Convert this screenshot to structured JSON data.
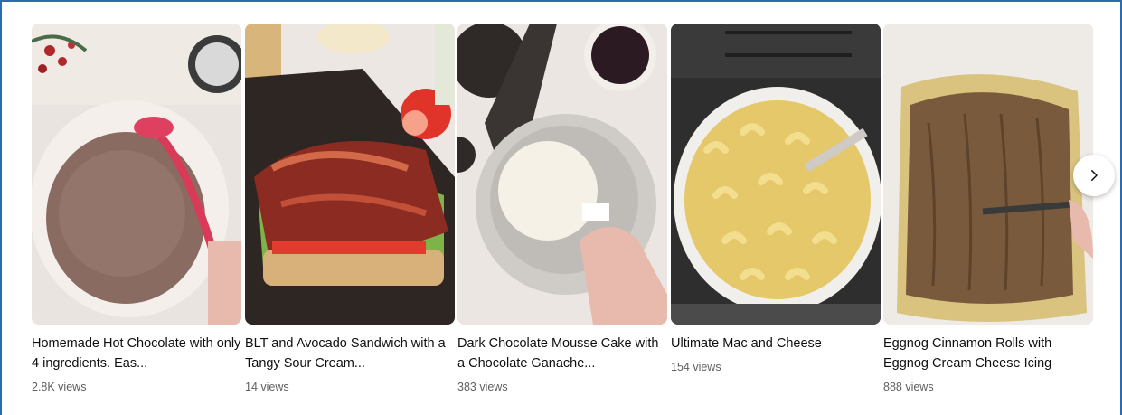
{
  "shelf": {
    "videos": [
      {
        "title": "Homemade Hot Chocolate with only 4 ingredients. Eas...",
        "views": "2.8K views"
      },
      {
        "title": "BLT and Avocado Sandwich with a Tangy Sour Cream...",
        "views": "14 views"
      },
      {
        "title": "Dark Chocolate Mousse Cake with a Chocolate Ganache...",
        "views": "383 views"
      },
      {
        "title": "Ultimate Mac and Cheese",
        "views": "154 views"
      },
      {
        "title": "Eggnog Cinnamon Rolls with Eggnog Cream Cheese Icing",
        "views": "888 views"
      }
    ],
    "next_icon": "chevron-right-icon"
  }
}
